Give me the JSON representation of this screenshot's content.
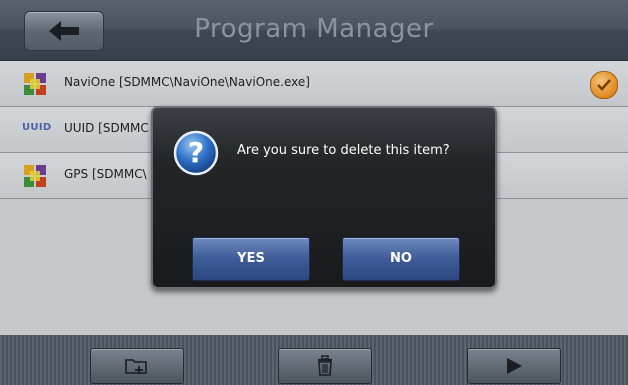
{
  "header": {
    "title": "Program Manager"
  },
  "list": {
    "items": [
      {
        "label": "NaviOne [SDMMC\\NaviOne\\NaviOne.exe]",
        "icon": "app-cube-icon",
        "checked": true
      },
      {
        "label": "UUID [SDMMC",
        "icon": "uuid-icon",
        "icon_text": "UUID",
        "checked": false
      },
      {
        "label": "GPS [SDMMC\\",
        "icon": "app-cube-icon",
        "checked": false
      }
    ]
  },
  "dialog": {
    "message": "Are you sure to delete this item?",
    "yes_label": "YES",
    "no_label": "NO",
    "icon": "question-icon"
  },
  "footer": {
    "buttons": [
      {
        "icon": "folder-add-icon"
      },
      {
        "icon": "trash-icon"
      },
      {
        "icon": "play-icon"
      }
    ]
  },
  "colors": {
    "header": "#3e4753",
    "dialog_button": "#3d5b97",
    "check": "#e08a1e"
  }
}
